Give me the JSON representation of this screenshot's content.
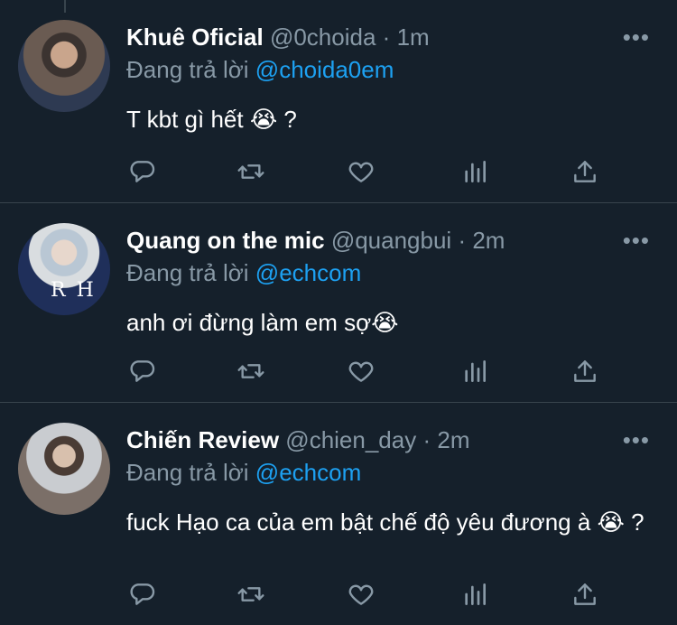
{
  "reply_prefix": "Đang trả lời",
  "more_label": "•••",
  "tweets": [
    {
      "name": "Khuê Oficial",
      "handle": "@0choida",
      "separator": "·",
      "time": "1m",
      "reply_to": "@choida0em",
      "text": "T kbt gì hết 😭 ?"
    },
    {
      "name": "Quang on the mic",
      "handle": "@quangbui",
      "separator": "·",
      "time": "2m",
      "reply_to": "@echcom",
      "text": "anh ơi đừng làm em sợ😭",
      "avatar_overlay": "RH"
    },
    {
      "name": "Chiến Review",
      "handle": "@chien_day",
      "separator": "·",
      "time": "2m",
      "reply_to": "@echcom",
      "text": "fuck Hạo ca của em bật chế độ yêu đương à 😭 ?"
    }
  ],
  "colors": {
    "background": "#15202b",
    "divider": "#38444d",
    "secondary_text": "#8899a6",
    "mention": "#1da1f2"
  },
  "icons": [
    "reply-icon",
    "retweet-icon",
    "like-icon",
    "analytics-icon",
    "share-icon"
  ]
}
